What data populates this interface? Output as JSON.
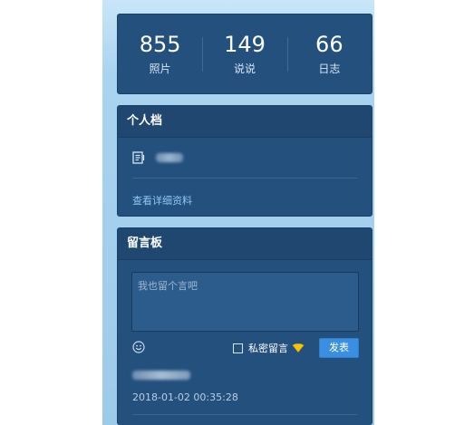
{
  "stats": [
    {
      "value": "855",
      "label": "照片"
    },
    {
      "value": "149",
      "label": "说说"
    },
    {
      "value": "66",
      "label": "日志"
    }
  ],
  "profile": {
    "title": "个人档",
    "icon": "id-card-icon",
    "link_label": "查看详细资料"
  },
  "guestbook": {
    "title": "留言板",
    "input_placeholder": "我也留个言吧",
    "private_label": "私密留言",
    "send_label": "发表",
    "messages": [
      {
        "time": "2018-01-02 00:35:28"
      }
    ]
  },
  "colors": {
    "card_bg": "#24507e",
    "link": "#8ec8f3",
    "button": "#3b8fe0",
    "vip": "#f7c600"
  }
}
